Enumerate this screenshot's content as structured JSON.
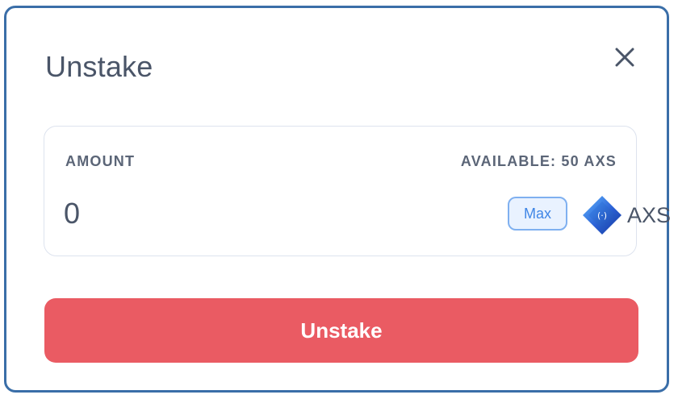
{
  "modal": {
    "title": "Unstake",
    "close_icon": "close-icon"
  },
  "amount_card": {
    "label": "AMOUNT",
    "available": "AVAILABLE: 50 AXS",
    "input_value": "0",
    "max_label": "Max",
    "token_icon": "axs-token-icon",
    "token_symbol": "AXS"
  },
  "actions": {
    "unstake_label": "Unstake"
  },
  "colors": {
    "accent_border": "#3a6ea8",
    "primary_button": "#ea5b63",
    "max_button_border": "#7fb0f0",
    "max_button_text": "#3f86e6",
    "text_primary": "#4a5568",
    "text_label": "#5b6577"
  }
}
